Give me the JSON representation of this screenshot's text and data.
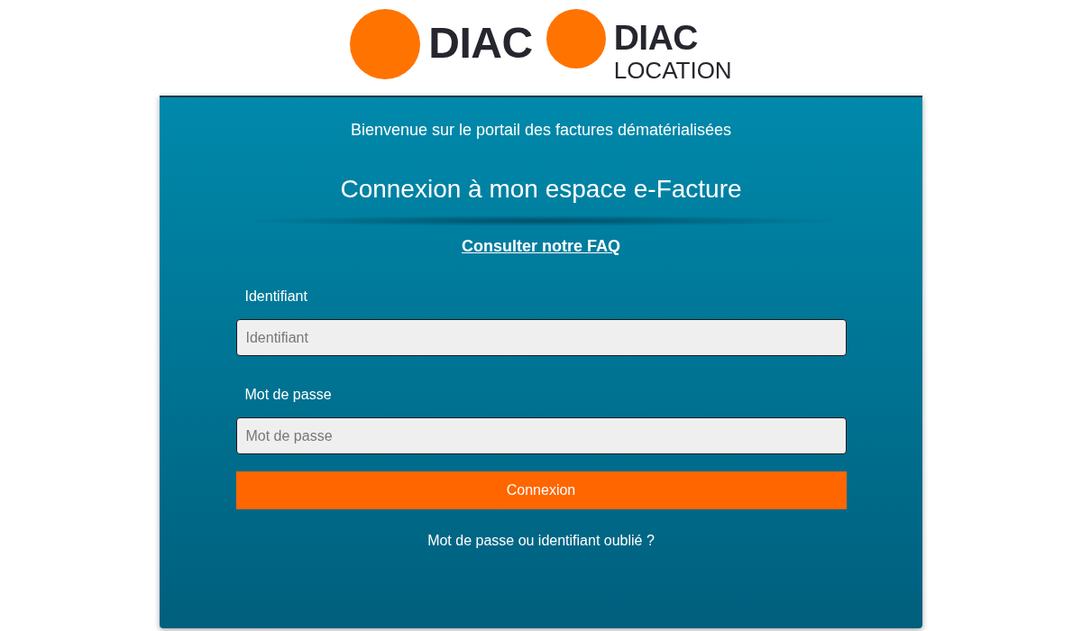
{
  "logos": [
    {
      "name": "DIAC"
    },
    {
      "name": "DIAC",
      "subtitle": "LOCATION"
    }
  ],
  "panel": {
    "welcome": "Bienvenue sur le portail des factures dématérialisées",
    "title": "Connexion à mon espace e-Facture",
    "faq_link": "Consulter notre FAQ"
  },
  "form": {
    "fields": [
      {
        "label": "Identifiant",
        "placeholder": "Identifiant"
      },
      {
        "label": "Mot de passe",
        "placeholder": "Mot de passe"
      }
    ],
    "submit": "Connexion",
    "forgot_link": "Mot de passe ou identifiant oublié ?"
  }
}
